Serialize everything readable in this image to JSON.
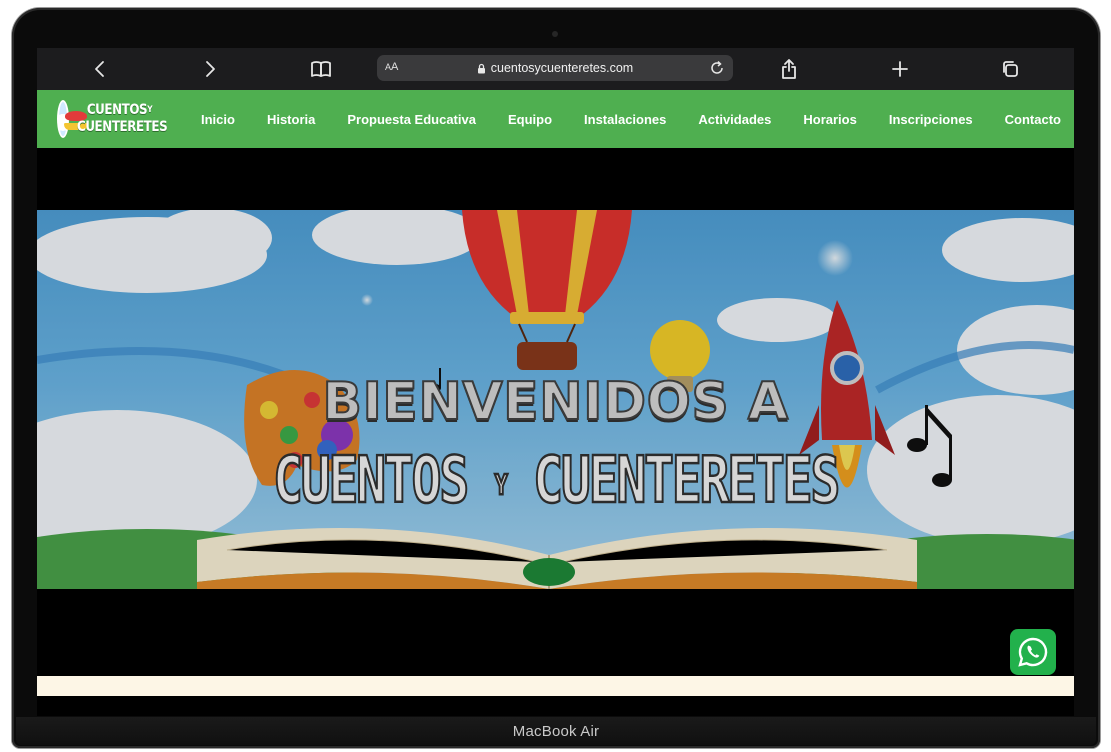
{
  "browser": {
    "back_icon": "chevron-left-icon",
    "forward_icon": "chevron-right-icon",
    "reader_icon": "book-icon",
    "text_size_label_small": "A",
    "text_size_label_large": "A",
    "url": "cuentosycuenteretes.com",
    "secure_icon": "lock-icon",
    "reload_icon": "reload-icon",
    "share_icon": "share-icon",
    "new_tab_icon": "plus-icon",
    "tabs_icon": "tabs-icon"
  },
  "site": {
    "logo_line1": "CUENTOS",
    "logo_y": "Y",
    "logo_line2": "CUENTERETES",
    "nav": [
      {
        "label": "Inicio"
      },
      {
        "label": "Historia"
      },
      {
        "label": "Propuesta Educativa"
      },
      {
        "label": "Equipo"
      },
      {
        "label": "Instalaciones"
      },
      {
        "label": "Actividades"
      },
      {
        "label": "Horarios"
      },
      {
        "label": "Inscripciones"
      },
      {
        "label": "Contacto"
      }
    ],
    "brand_color": "#4faf50"
  },
  "hero": {
    "title": "BIENVENIDOS A",
    "brand_part1": "CUENTOS",
    "brand_y": "Y",
    "brand_part2": "CUENTERETES"
  },
  "whatsapp": {
    "icon": "whatsapp-icon",
    "color": "#22b14c"
  },
  "device": {
    "label": "MacBook Air"
  }
}
